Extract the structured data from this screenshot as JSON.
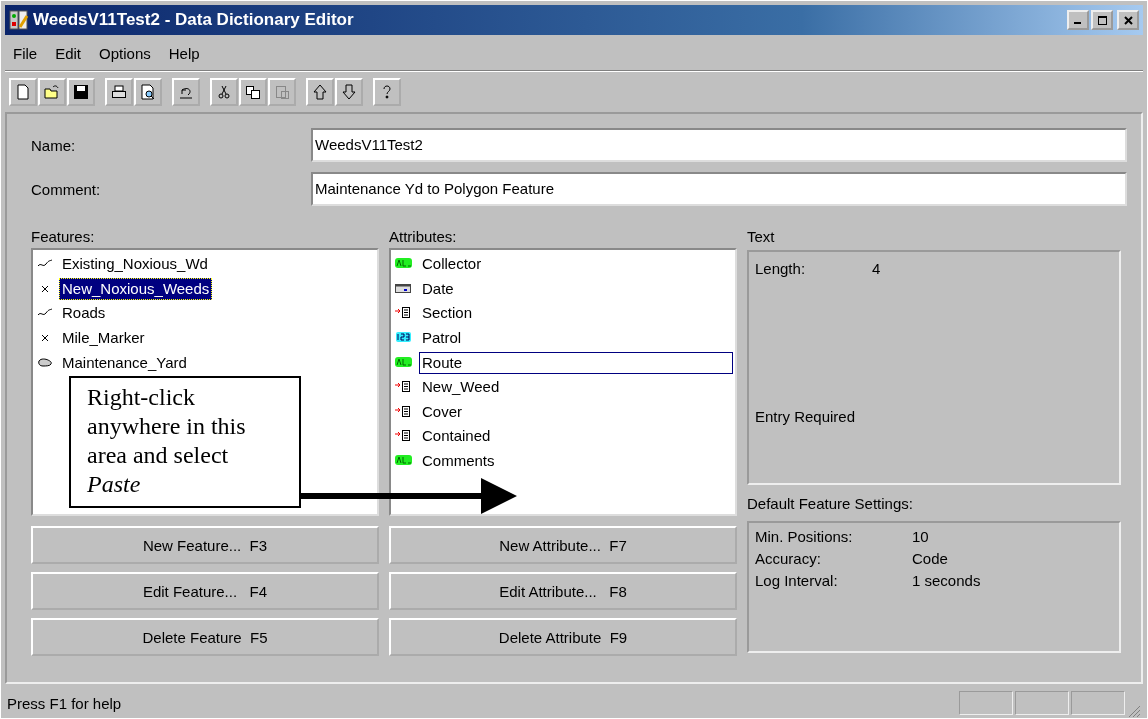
{
  "window": {
    "title": "WeedsV11Test2 - Data Dictionary Editor"
  },
  "menu": [
    {
      "label": "File"
    },
    {
      "label": "Edit"
    },
    {
      "label": "Options"
    },
    {
      "label": "Help"
    }
  ],
  "toolbar": [
    {
      "buttons": [
        {
          "kind": "new",
          "disabled": false
        },
        {
          "kind": "open",
          "disabled": false
        },
        {
          "kind": "save",
          "disabled": false
        }
      ]
    },
    {
      "buttons": [
        {
          "kind": "print",
          "disabled": false
        },
        {
          "kind": "preview",
          "disabled": false
        }
      ]
    },
    {
      "buttons": [
        {
          "kind": "undo",
          "disabled": false
        }
      ]
    },
    {
      "buttons": [
        {
          "kind": "cut",
          "disabled": false
        },
        {
          "kind": "copy",
          "disabled": false
        },
        {
          "kind": "paste",
          "disabled": true
        }
      ]
    },
    {
      "buttons": [
        {
          "kind": "up",
          "disabled": false
        },
        {
          "kind": "down",
          "disabled": false
        }
      ]
    },
    {
      "buttons": [
        {
          "kind": "help",
          "disabled": false
        }
      ]
    }
  ],
  "form": {
    "name_label": "Name:",
    "name_value": "WeedsV11Test2",
    "comment_label": "Comment:",
    "comment_value": "Maintenance Yd to Polygon Feature"
  },
  "features": {
    "label": "Features:",
    "items": [
      {
        "kind": "line",
        "label": "Existing_Noxious_Wd",
        "selected": false
      },
      {
        "kind": "point",
        "label": "New_Noxious_Weeds",
        "selected": true
      },
      {
        "kind": "line",
        "label": "Roads",
        "selected": false
      },
      {
        "kind": "point",
        "label": "Mile_Marker",
        "selected": false
      },
      {
        "kind": "area",
        "label": "Maintenance_Yard",
        "selected": false
      }
    ]
  },
  "attributes": {
    "label": "Attributes:",
    "items": [
      {
        "kind": "text",
        "label": "Collector",
        "focused": false
      },
      {
        "kind": "date",
        "label": "Date",
        "focused": false
      },
      {
        "kind": "menu",
        "label": "Section",
        "focused": false
      },
      {
        "kind": "numeric",
        "label": "Patrol",
        "focused": false
      },
      {
        "kind": "text",
        "label": "Route",
        "focused": true
      },
      {
        "kind": "menu",
        "label": "New_Weed",
        "focused": false
      },
      {
        "kind": "menu",
        "label": "Cover",
        "focused": false
      },
      {
        "kind": "menu",
        "label": "Contained",
        "focused": false
      },
      {
        "kind": "text",
        "label": "Comments",
        "focused": false
      }
    ]
  },
  "details": {
    "heading": "Text",
    "rows": [
      {
        "label": "Length:",
        "value": "4"
      }
    ],
    "note": "Entry Required"
  },
  "defaults": {
    "heading": "Default Feature Settings:",
    "rows": [
      {
        "label": "Min. Positions:",
        "value": "10"
      },
      {
        "label": "Accuracy:",
        "value": "Code"
      },
      {
        "label": "Log Interval:",
        "value": "1 seconds"
      }
    ]
  },
  "feature_buttons": [
    "New Feature...  F3",
    "Edit Feature...   F4",
    "Delete Feature  F5"
  ],
  "attribute_buttons": [
    "New Attribute...  F7",
    "Edit Attribute...   F8",
    "Delete Attribute  F9"
  ],
  "callout": {
    "text": "Right-click anywhere in this area and select *Paste*"
  },
  "status_bar": {
    "text": "Press F1 for help"
  }
}
